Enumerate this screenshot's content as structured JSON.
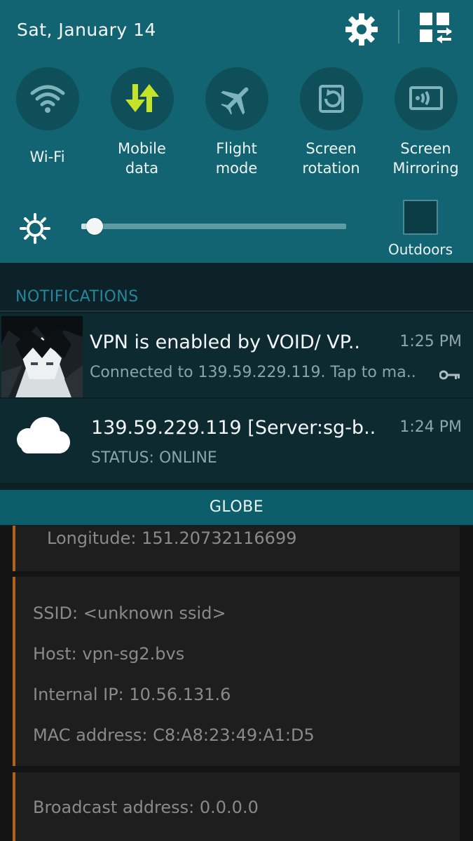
{
  "status": {
    "date": "Sat, January 14"
  },
  "quick_settings": {
    "toggles": [
      {
        "label": "Wi-Fi",
        "icon": "wifi-icon",
        "active": false
      },
      {
        "label": "Mobile\ndata",
        "icon": "mobile-data-icon",
        "active": true
      },
      {
        "label": "Flight\nmode",
        "icon": "airplane-icon",
        "active": false
      },
      {
        "label": "Screen\nrotation",
        "icon": "screen-rotation-icon",
        "active": false
      },
      {
        "label": "Screen\nMirroring",
        "icon": "screen-mirroring-icon",
        "active": false
      }
    ],
    "brightness": {
      "level": 0.05,
      "outdoors_label": "Outdoors"
    }
  },
  "notifications": {
    "header": "NOTIFICATIONS",
    "items": [
      {
        "title": "VPN is enabled by VOID/ VP..",
        "text": "Connected to 139.59.229.119. Tap to ma..",
        "time": "1:25 PM"
      },
      {
        "title": "139.59.229.119 [Server:sg-b..",
        "text": "STATUS: ONLINE",
        "time": "1:24 PM"
      }
    ],
    "carrier": "GLOBE"
  },
  "app": {
    "longitude": "Longitude: 151.20732116699",
    "ssid": "SSID: <unknown ssid>",
    "host": "Host: vpn-sg2.bvs",
    "internal_ip": "Internal IP: 10.56.131.6",
    "mac": "MAC address: C8:A8:23:49:A1:D5",
    "broadcast": "Broadcast address: 0.0.0.0"
  },
  "colors": {
    "panel_teal": "#126472",
    "mobile_data_active": "#c6e32b",
    "notif_header": "#26879a",
    "app_accent": "#b3621c"
  }
}
